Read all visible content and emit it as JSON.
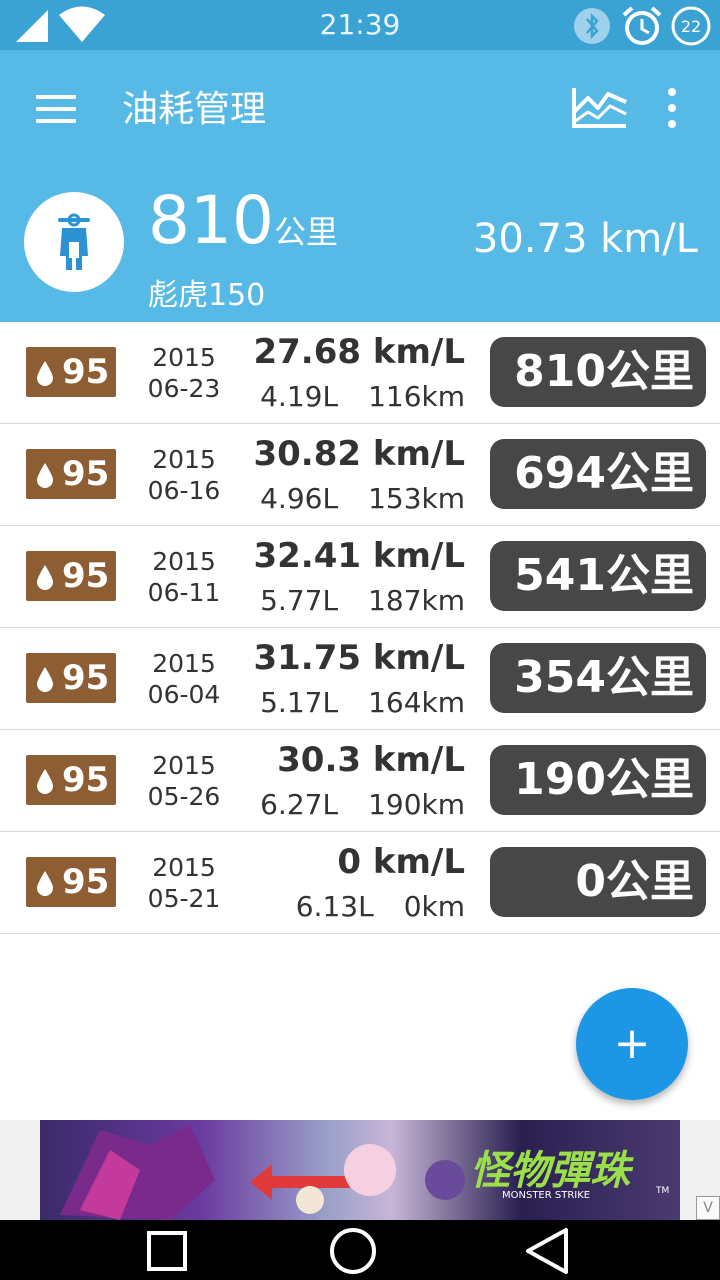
{
  "status_bar": {
    "time": "21:39",
    "notification_count": "22"
  },
  "app_bar": {
    "title": "油耗管理",
    "menu_icon": "hamburger-icon",
    "chart_icon": "chart-icon",
    "more_icon": "more-vert-icon"
  },
  "summary": {
    "odometer": "810",
    "odometer_unit": "公里",
    "vehicle": "彪虎150",
    "average": "30.73 km/L"
  },
  "records": [
    {
      "octane": "95",
      "year": "2015",
      "date": "06-23",
      "efficiency": "27.68 km/L",
      "liters": "4.19L",
      "distance": "116km",
      "odometer": "810公里"
    },
    {
      "octane": "95",
      "year": "2015",
      "date": "06-16",
      "efficiency": "30.82 km/L",
      "liters": "4.96L",
      "distance": "153km",
      "odometer": "694公里"
    },
    {
      "octane": "95",
      "year": "2015",
      "date": "06-11",
      "efficiency": "32.41 km/L",
      "liters": "5.77L",
      "distance": "187km",
      "odometer": "541公里"
    },
    {
      "octane": "95",
      "year": "2015",
      "date": "06-04",
      "efficiency": "31.75 km/L",
      "liters": "5.17L",
      "distance": "164km",
      "odometer": "354公里"
    },
    {
      "octane": "95",
      "year": "2015",
      "date": "05-26",
      "efficiency": "30.3 km/L",
      "liters": "6.27L",
      "distance": "190km",
      "odometer": "190公里"
    },
    {
      "octane": "95",
      "year": "2015",
      "date": "05-21",
      "efficiency": "0 km/L",
      "liters": "6.13L",
      "distance": "0km",
      "odometer": "0公里"
    }
  ],
  "fab": {
    "label": "+"
  },
  "ad": {
    "title": "怪物彈珠",
    "subtitle": "MONSTER STRIKE",
    "tm": "TM",
    "close_label": "V"
  },
  "colors": {
    "status_bar": "#3aa3d4",
    "app_bar": "#56b9e6",
    "badge": "#8d5d33",
    "pill": "#474747",
    "fab": "#1e96e6"
  }
}
